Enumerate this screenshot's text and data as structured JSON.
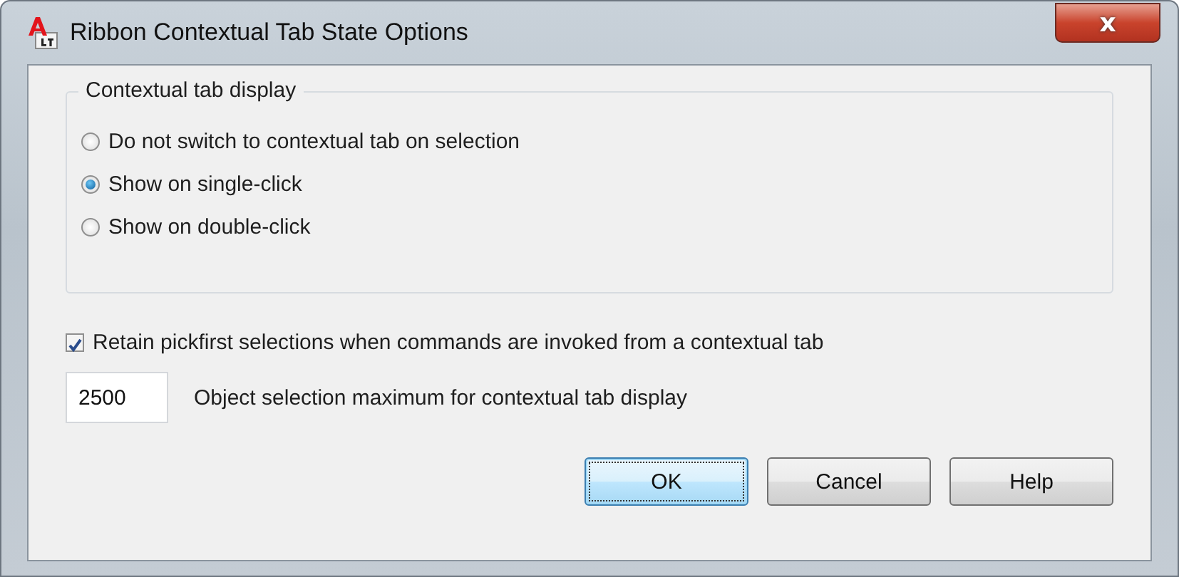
{
  "window": {
    "title": "Ribbon Contextual Tab State Options",
    "close_label": "x"
  },
  "group": {
    "title": "Contextual tab display",
    "options": [
      {
        "label": "Do not switch to contextual tab on selection",
        "selected": false
      },
      {
        "label": "Show on single-click",
        "selected": true
      },
      {
        "label": "Show on double-click",
        "selected": false
      }
    ]
  },
  "retain": {
    "label": "Retain pickfirst selections when commands are invoked from a contextual tab",
    "checked": true
  },
  "maximum": {
    "value": "2500",
    "label": "Object selection maximum for contextual tab display"
  },
  "buttons": [
    {
      "label": "OK",
      "focused": true
    },
    {
      "label": "Cancel",
      "focused": false
    },
    {
      "label": "Help",
      "focused": false
    }
  ]
}
